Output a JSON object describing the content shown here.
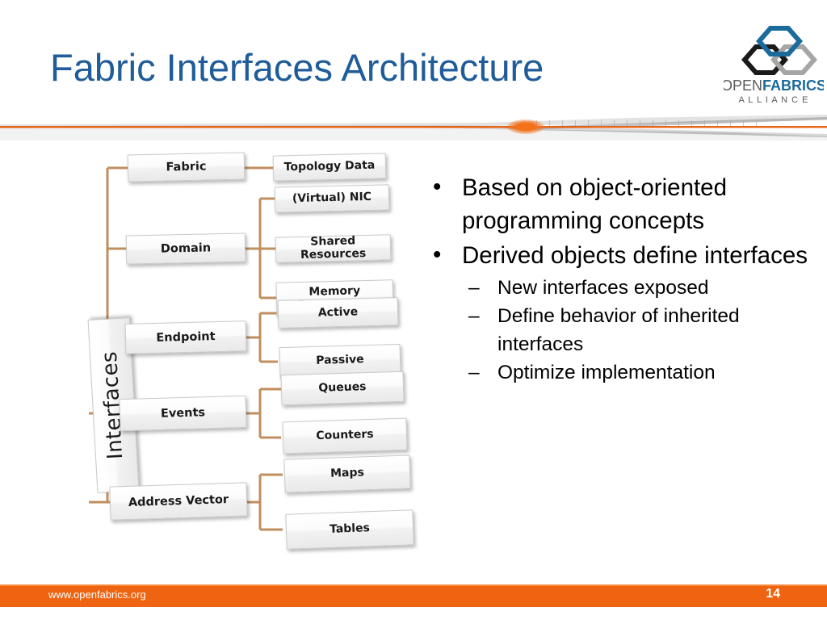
{
  "slide": {
    "title": "Fabric Interfaces Architecture",
    "title_color": "#1F5C99",
    "accent_color": "#EF6410",
    "connector_color": "#BF8F5F"
  },
  "logo": {
    "alt": "OpenFabrics Alliance logo",
    "word_open": "OPEN",
    "word_fabrics": "FABRICS",
    "word_alliance": "A L L I A N C E",
    "hex_blue": "#1B6A9C",
    "hex_black": "#1A1A1A",
    "hex_gray": "#A6A6A6"
  },
  "diagram": {
    "root": "Interfaces",
    "branches": [
      {
        "label": "Fabric",
        "children": [
          "Topology Data"
        ]
      },
      {
        "label": "Domain",
        "children": [
          "(Virtual) NIC",
          "Shared Resources",
          "Memory Descriptors"
        ]
      },
      {
        "label": "Endpoint",
        "children": [
          "Active",
          "Passive"
        ]
      },
      {
        "label": "Events",
        "children": [
          "Queues",
          "Counters"
        ]
      },
      {
        "label": "Address Vector",
        "children": [
          "Maps",
          "Tables"
        ]
      }
    ]
  },
  "bullets": [
    {
      "marker": "•",
      "text": "Based on object-oriented programming concepts",
      "children": []
    },
    {
      "marker": "•",
      "text": "Derived objects define interfaces",
      "children": [
        {
          "marker": "–",
          "text": "New interfaces exposed"
        },
        {
          "marker": "–",
          "text": "Define behavior of inherited interfaces"
        },
        {
          "marker": "–",
          "text": "Optimize implementation"
        }
      ]
    }
  ],
  "footer": {
    "url": "www.openfabrics.org",
    "page_number": "14"
  }
}
